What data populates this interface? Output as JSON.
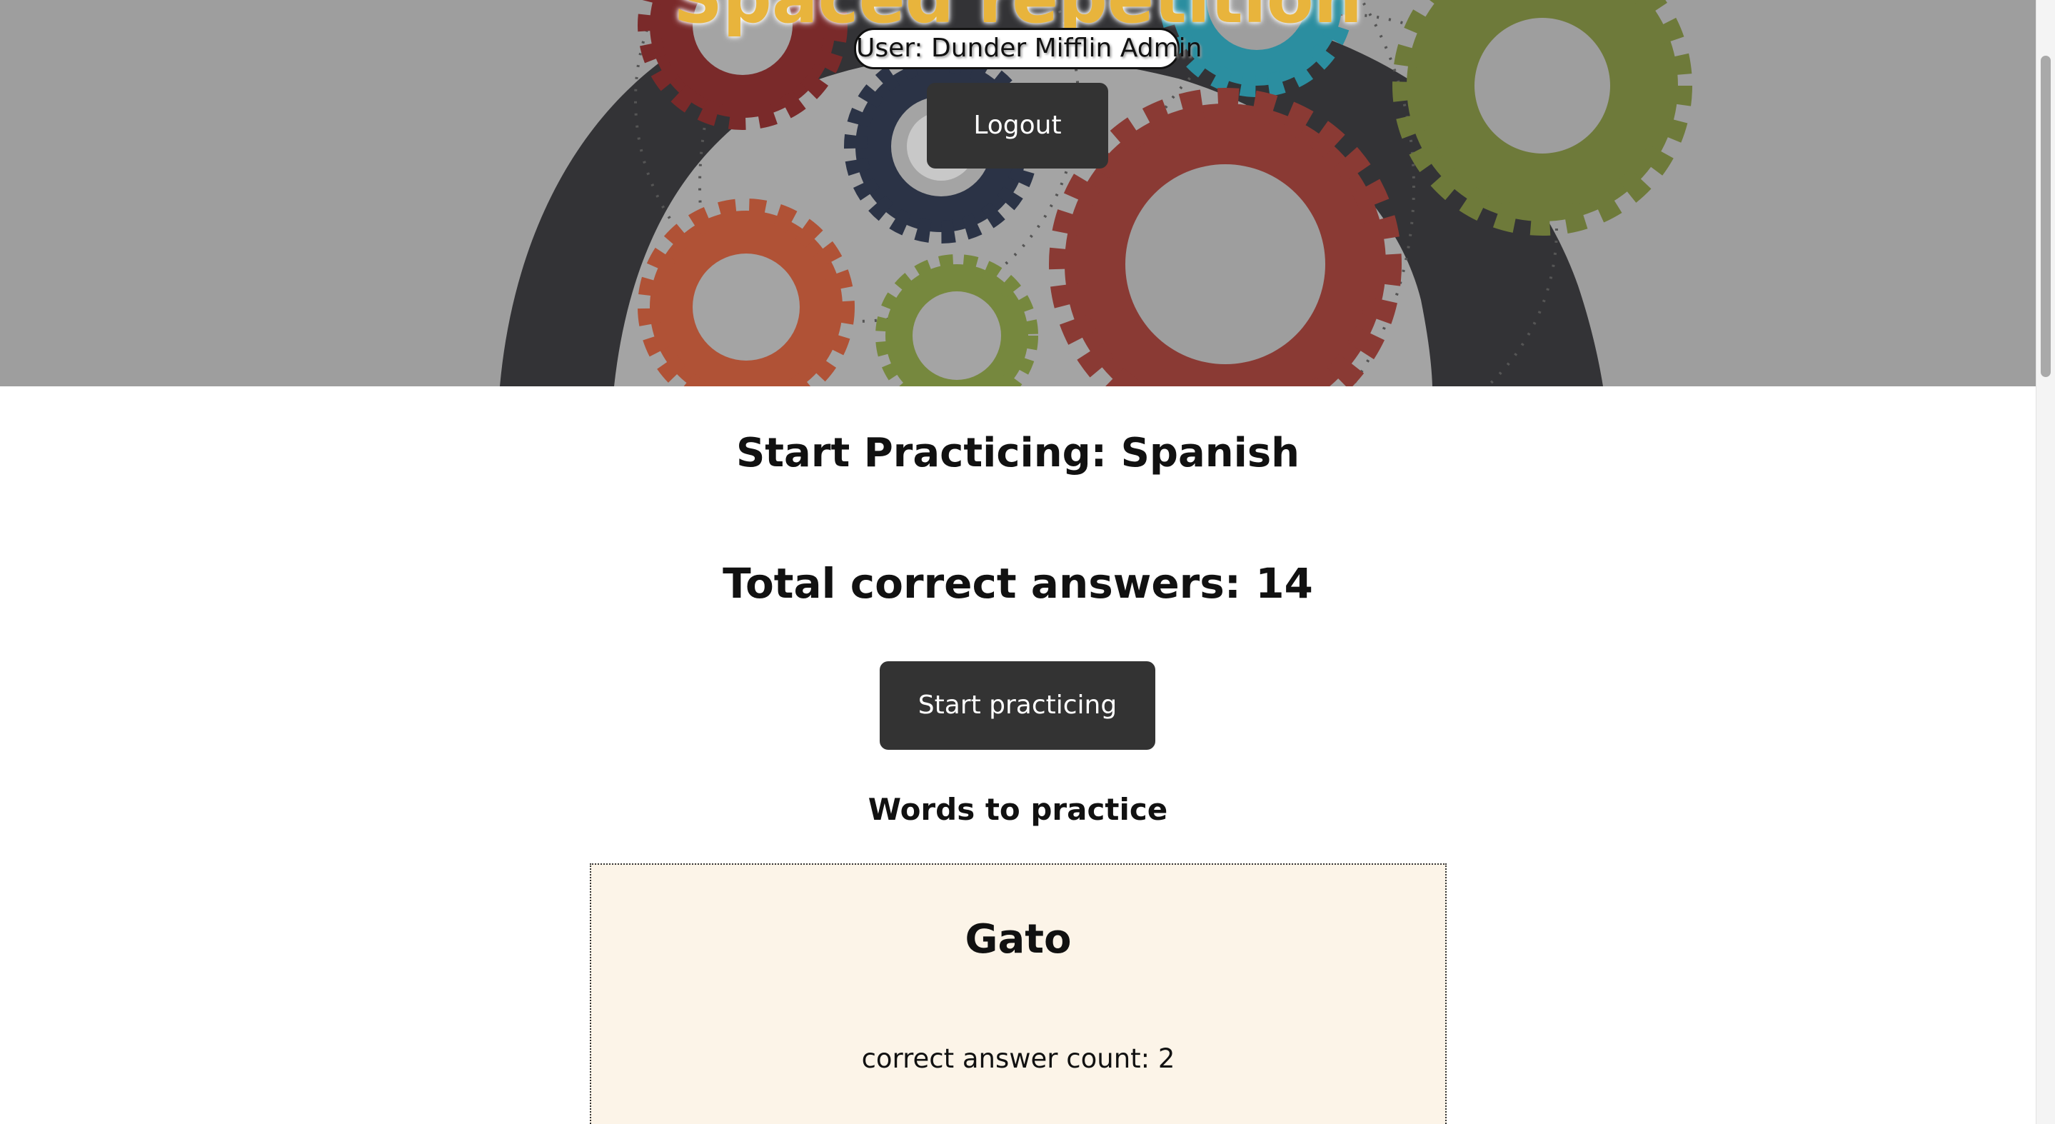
{
  "header": {
    "title": "Spaced repetition",
    "user_label": "User: Dunder Mifflin Admin",
    "logout_label": "Logout"
  },
  "main": {
    "practice_heading": "Start Practicing: Spanish",
    "total_correct": "Total correct answers: 14",
    "start_button_label": "Start practicing",
    "words_heading": "Words to practice",
    "words": [
      {
        "word": "Gato",
        "count_text": "correct answer count: 2"
      }
    ]
  },
  "colors": {
    "hero_background": "#9e9e9e",
    "title_color": "#e8b43c",
    "button_background": "#333333",
    "card_background": "#fcf4e8"
  }
}
